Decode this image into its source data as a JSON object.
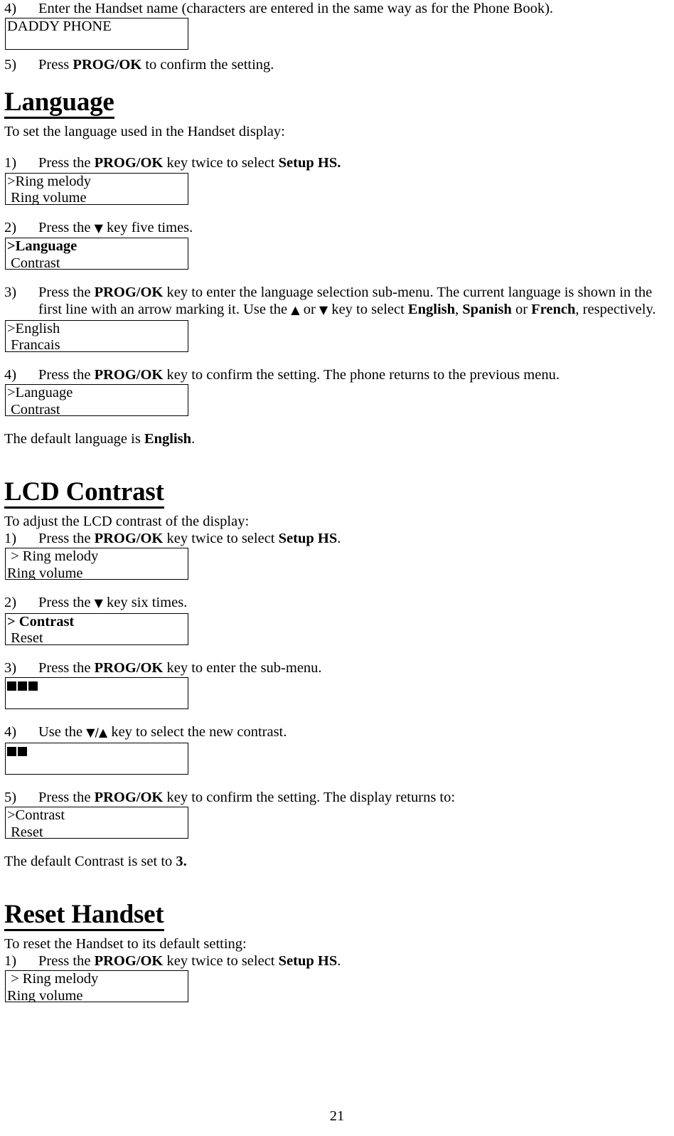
{
  "document": {
    "page_number": "21",
    "handset_name_entry": {
      "step_number": "4)",
      "text": "Enter the Handset name (characters are entered in the same way as for the Phone Book).",
      "display_value": "DADDY PHONE"
    },
    "confirm_step": {
      "step_number": "5)",
      "prefix": "Press ",
      "key": "PROG/OK",
      "suffix": " to confirm the setting."
    },
    "sections": [
      {
        "heading": "Language",
        "intro": "To set the language used in the Handset display:",
        "steps": [
          {
            "number": "1)",
            "parts": [
              {
                "t": "Press the ",
                "b": false
              },
              {
                "t": "PROG/OK",
                "b": true
              },
              {
                "t": " key twice to select ",
                "b": false
              },
              {
                "t": "Setup HS.",
                "b": true
              }
            ],
            "display": {
              "line1": ">Ring melody",
              "line2": " Ring volume",
              "bold1": false
            }
          },
          {
            "number": "2)",
            "parts": [
              {
                "t": "Press the ",
                "b": false
              },
              {
                "t": "▼",
                "b": false
              },
              {
                "t": " key five times.",
                "b": false
              }
            ],
            "display": {
              "line1": ">Language",
              "line2": " Contrast",
              "bold1": true
            }
          },
          {
            "number": "3)",
            "parts": [
              {
                "t": "Press the ",
                "b": false
              },
              {
                "t": "PROG/OK",
                "b": true
              },
              {
                "t": " key to enter the language selection sub-menu. The current language is shown in the first line with an arrow marking it. Use the ",
                "b": false
              },
              {
                "t": "▲",
                "b": false
              },
              {
                "t": " or ",
                "b": false
              },
              {
                "t": "▼",
                "b": false
              },
              {
                "t": " key to select ",
                "b": false
              },
              {
                "t": "English",
                "b": true
              },
              {
                "t": ", ",
                "b": false
              },
              {
                "t": "Spanish",
                "b": true
              },
              {
                "t": " or ",
                "b": false
              },
              {
                "t": "French",
                "b": true
              },
              {
                "t": ", respectively.",
                "b": false
              }
            ],
            "display": {
              "line1": ">English",
              "line2": " Francais",
              "bold1": false
            }
          },
          {
            "number": "4)",
            "parts": [
              {
                "t": "Press the ",
                "b": false
              },
              {
                "t": "PROG/OK",
                "b": true
              },
              {
                "t": " key to confirm the setting. The phone returns to the previous menu.",
                "b": false
              }
            ],
            "display": {
              "line1": ">Language",
              "line2": " Contrast",
              "bold1": false
            }
          }
        ],
        "footer": {
          "prefix": "The default language is ",
          "value": "English",
          "suffix": "."
        }
      },
      {
        "heading": "LCD Contrast",
        "intro": "To adjust the LCD contrast of the display:",
        "steps": [
          {
            "number": "1)",
            "parts": [
              {
                "t": "Press the ",
                "b": false
              },
              {
                "t": "PROG/OK",
                "b": true
              },
              {
                "t": " key twice to select ",
                "b": false
              },
              {
                "t": "Setup HS",
                "b": true
              },
              {
                "t": ".",
                "b": false
              }
            ],
            "display": {
              "line1": " > Ring melody",
              "line2": "Ring volume",
              "bold1": false
            }
          },
          {
            "number": "2)",
            "parts": [
              {
                "t": "Press the ",
                "b": false
              },
              {
                "t": "▼",
                "b": false
              },
              {
                "t": " key six times.",
                "b": false
              }
            ],
            "display": {
              "line1": "> Contrast",
              "line2": " Reset",
              "bold1": true
            }
          },
          {
            "number": "3)",
            "parts": [
              {
                "t": "Press the ",
                "b": false
              },
              {
                "t": "PROG/OK",
                "b": true
              },
              {
                "t": " key to enter the sub-menu.",
                "b": false
              }
            ],
            "display": {
              "squares": 3
            }
          },
          {
            "number": "4)",
            "parts": [
              {
                "t": "Use the ",
                "b": false
              },
              {
                "t": "▼/▲",
                "b": false
              },
              {
                "t": " key to select the new contrast.",
                "b": false
              }
            ],
            "display": {
              "squares": 2
            }
          },
          {
            "number": "5)",
            "parts": [
              {
                "t": "Press the ",
                "b": false
              },
              {
                "t": "PROG/OK",
                "b": true
              },
              {
                "t": " key to confirm the setting.  The display returns to:",
                "b": false
              }
            ],
            "display": {
              "line1": ">Contrast",
              "line2": " Reset",
              "bold1": false
            }
          }
        ],
        "footer": {
          "prefix": "The default Contrast is set to ",
          "value": "3.",
          "suffix": ""
        }
      },
      {
        "heading": "Reset Handset",
        "intro": "To reset the Handset to its default setting:",
        "steps": [
          {
            "number": "1)",
            "parts": [
              {
                "t": "Press the ",
                "b": false
              },
              {
                "t": "PROG/OK",
                "b": true
              },
              {
                "t": " key twice to select ",
                "b": false
              },
              {
                "t": "Setup HS",
                "b": true
              },
              {
                "t": ".",
                "b": false
              }
            ],
            "display": {
              "line1": " > Ring melody",
              "line2": "Ring volume",
              "bold1": false
            }
          }
        ],
        "footer": null
      }
    ]
  }
}
